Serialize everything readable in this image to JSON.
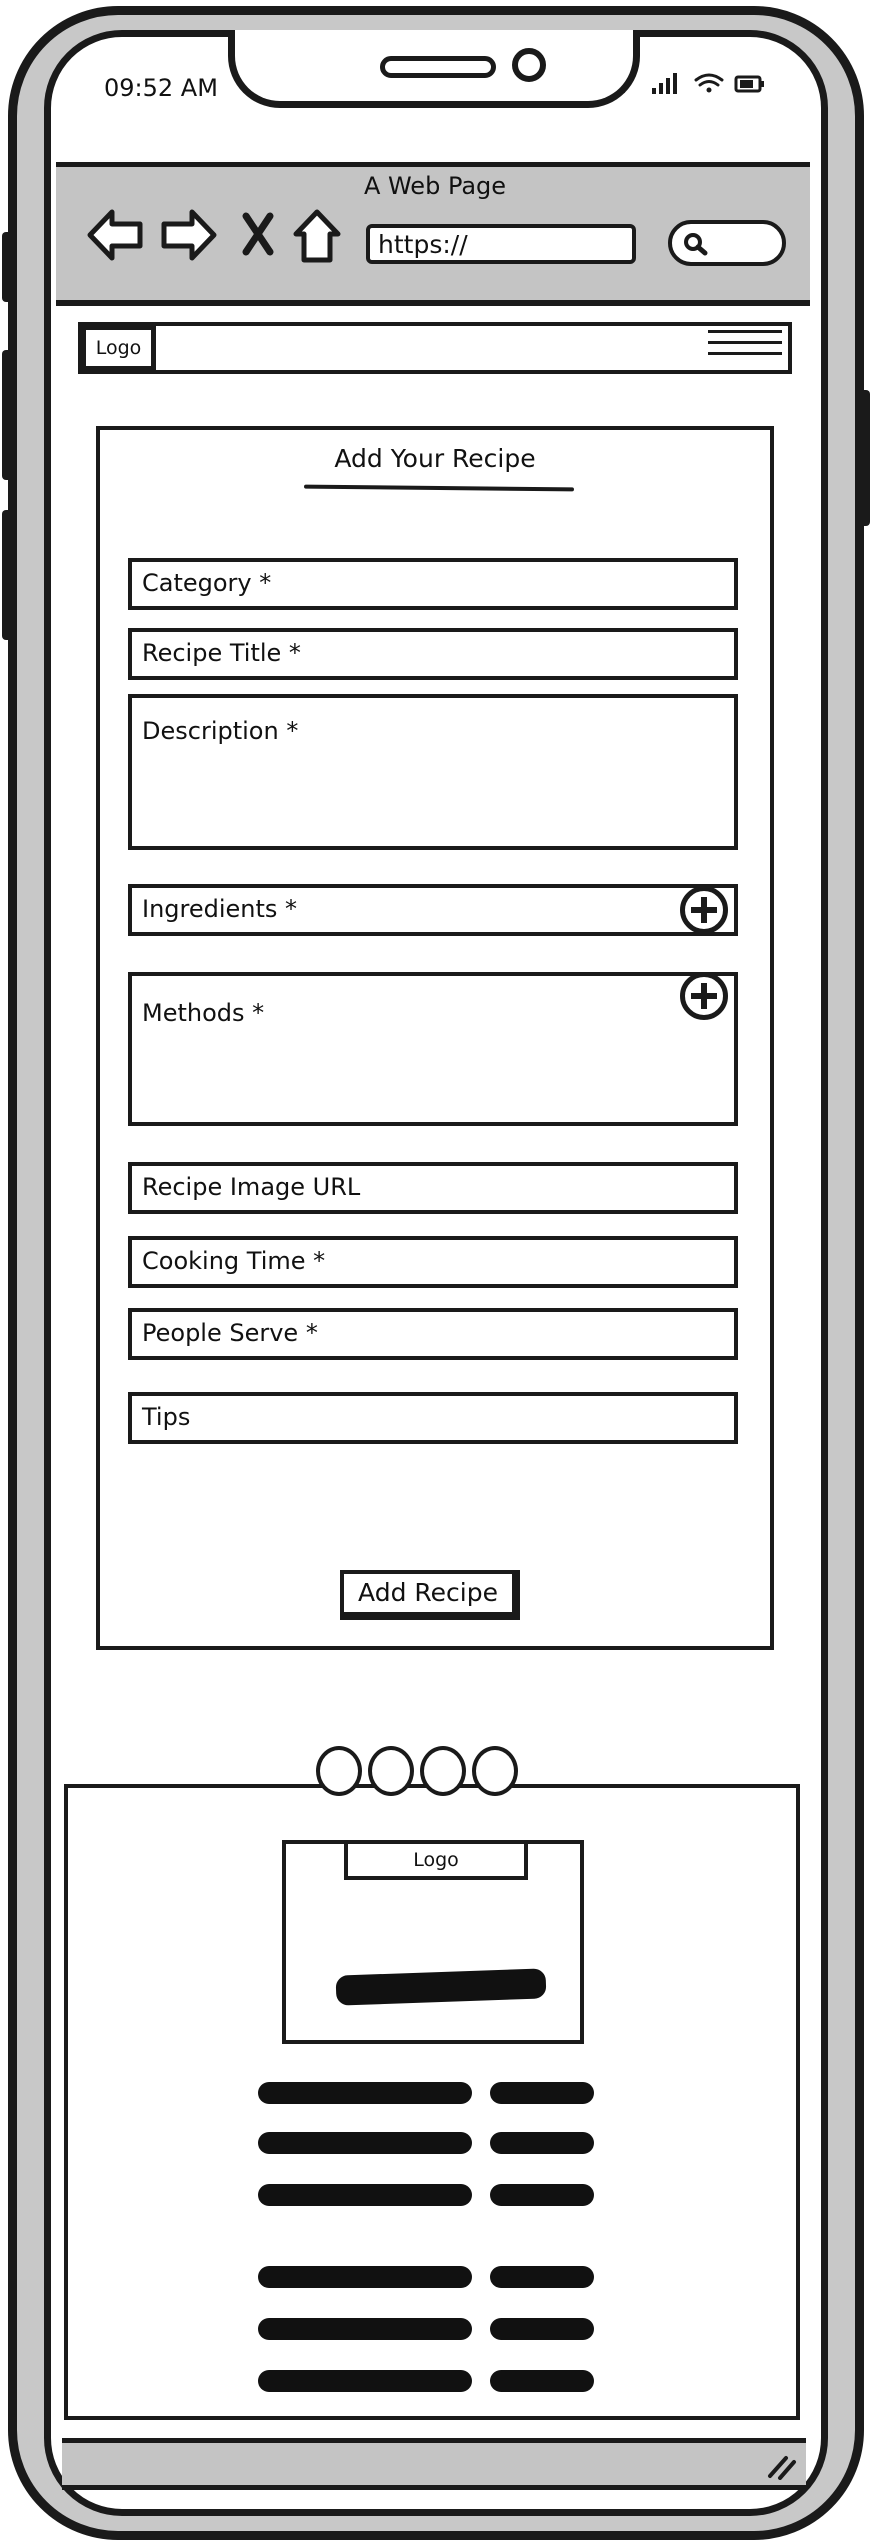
{
  "status_bar": {
    "time": "09:52 AM"
  },
  "browser": {
    "title": "A Web Page",
    "url": "https://"
  },
  "header": {
    "logo": "Logo"
  },
  "form": {
    "title": "Add Your Recipe",
    "fields": {
      "category": "Category *",
      "recipe_title": "Recipe Title *",
      "description": "Description *",
      "ingredients": "Ingredients *",
      "methods": "Methods *",
      "image_url": "Recipe Image URL",
      "cooking_time": "Cooking Time *",
      "people_serve": "People Serve *",
      "tips": "Tips"
    },
    "submit_label": "Add Recipe"
  },
  "footer": {
    "logo": "Logo"
  },
  "icons": [
    "back-arrow-icon",
    "forward-arrow-icon",
    "close-icon",
    "home-icon",
    "search-icon",
    "plus-icon",
    "signal-icon",
    "wifi-icon",
    "battery-icon",
    "resize-grip-icon"
  ]
}
